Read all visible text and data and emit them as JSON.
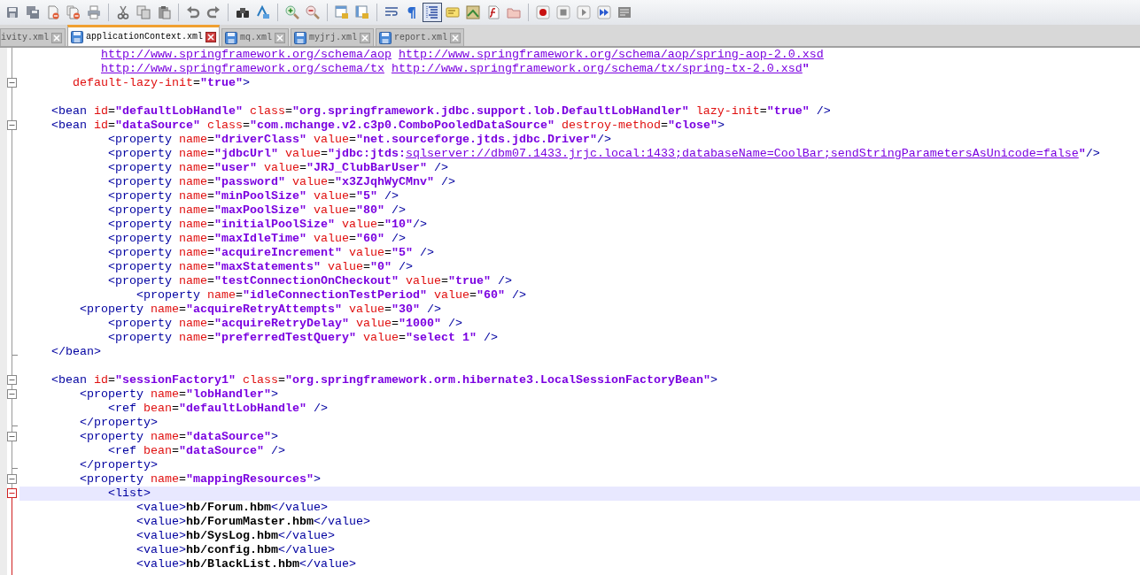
{
  "toolbar": [
    {
      "kind": "save",
      "pressed": false
    },
    {
      "kind": "save-all",
      "pressed": false
    },
    {
      "kind": "close-file",
      "pressed": false
    },
    {
      "kind": "close-all",
      "pressed": false
    },
    {
      "kind": "print",
      "pressed": false
    },
    {
      "kind": "separator"
    },
    {
      "kind": "cut",
      "pressed": false
    },
    {
      "kind": "copy",
      "pressed": false
    },
    {
      "kind": "paste",
      "pressed": false
    },
    {
      "kind": "separator"
    },
    {
      "kind": "undo",
      "pressed": false
    },
    {
      "kind": "redo",
      "pressed": false
    },
    {
      "kind": "separator"
    },
    {
      "kind": "find",
      "pressed": false
    },
    {
      "kind": "replace",
      "pressed": false
    },
    {
      "kind": "separator"
    },
    {
      "kind": "zoom-in",
      "pressed": false
    },
    {
      "kind": "zoom-out",
      "pressed": false
    },
    {
      "kind": "separator"
    },
    {
      "kind": "sync-vertical",
      "pressed": false
    },
    {
      "kind": "sync-horizontal",
      "pressed": false
    },
    {
      "kind": "separator"
    },
    {
      "kind": "word-wrap",
      "pressed": false
    },
    {
      "kind": "show-all",
      "pressed": false
    },
    {
      "kind": "indent-guide",
      "pressed": true
    },
    {
      "kind": "language",
      "pressed": false
    },
    {
      "kind": "doc-map",
      "pressed": false
    },
    {
      "kind": "function-list",
      "pressed": false
    },
    {
      "kind": "folder",
      "pressed": false
    },
    {
      "kind": "separator"
    },
    {
      "kind": "record",
      "pressed": false
    },
    {
      "kind": "stop",
      "pressed": false
    },
    {
      "kind": "play",
      "pressed": false
    },
    {
      "kind": "play-multiple",
      "pressed": false
    },
    {
      "kind": "save-macro",
      "pressed": false
    }
  ],
  "tabs": [
    {
      "label": "ivity.xml",
      "selected": false,
      "show_icon": false
    },
    {
      "label": "applicationContext.xml",
      "selected": true,
      "show_icon": true
    },
    {
      "label": "mq.xml",
      "selected": false,
      "show_icon": true
    },
    {
      "label": "myjrj.xml",
      "selected": false,
      "show_icon": true
    },
    {
      "label": "report.xml",
      "selected": false,
      "show_icon": true
    }
  ],
  "lines": [
    {
      "fold_start": false,
      "fold_end": false,
      "current": false,
      "segments": [
        {
          "kind": "link",
          "text": "http://www.springframework.org/schema/aop"
        },
        {
          "kind": "link",
          "text": "http://www.springframework.org/schema/aop/spring-aop-2.0.xsd"
        }
      ]
    },
    {
      "fold_start": false,
      "fold_end": false,
      "current": false,
      "segments": [
        {
          "kind": "link",
          "text": "http://www.springframework.org/schema/tx"
        },
        {
          "kind": "link",
          "text": "http://www.springframework.org/schema/tx/spring-tx-2.0.xsd"
        },
        {
          "kind": "value",
          "text": "\""
        }
      ]
    },
    {
      "fold_start": true,
      "fold_end": false,
      "current": false,
      "segments": [
        {
          "kind": "attr",
          "text": "default-lazy-init"
        },
        {
          "kind": "plain",
          "text": "="
        },
        {
          "kind": "value",
          "text": "\"true\""
        },
        {
          "kind": "tag",
          "text": ">"
        }
      ]
    },
    {
      "fold_start": false,
      "fold_end": false,
      "current": false
    },
    {
      "fold_start": false,
      "fold_end": false,
      "current": false,
      "segments": [
        {
          "kind": "tag",
          "text": "<bean"
        },
        {
          "kind": "attr",
          "text": " id"
        },
        {
          "kind": "plain",
          "text": "="
        },
        {
          "kind": "value",
          "text": "\"defaultLobHandle\""
        },
        {
          "kind": "attr",
          "text": " class"
        },
        {
          "kind": "plain",
          "text": "="
        },
        {
          "kind": "value",
          "text": "\"org.springframework.jdbc.support.lob.DefaultLobHandler\""
        },
        {
          "kind": "attr",
          "text": " lazy-init"
        },
        {
          "kind": "plain",
          "text": "="
        },
        {
          "kind": "value",
          "text": "\"true\""
        },
        {
          "kind": "tag",
          "text": " />"
        }
      ]
    },
    {
      "fold_start": true,
      "fold_end": false,
      "current": false,
      "segments": [
        {
          "kind": "tag",
          "text": "<bean"
        },
        {
          "kind": "attr",
          "text": " id"
        },
        {
          "kind": "plain",
          "text": "="
        },
        {
          "kind": "value",
          "text": "\"dataSource\""
        },
        {
          "kind": "attr",
          "text": " class"
        },
        {
          "kind": "plain",
          "text": "="
        },
        {
          "kind": "value",
          "text": "\"com.mchange.v2.c3p0.ComboPooledDataSource\""
        },
        {
          "kind": "attr",
          "text": " destroy-method"
        },
        {
          "kind": "plain",
          "text": "="
        },
        {
          "kind": "value",
          "text": "\"close\""
        },
        {
          "kind": "tag",
          "text": ">"
        }
      ]
    },
    {
      "fold_start": false,
      "fold_end": false,
      "current": false,
      "segments": [
        {
          "kind": "tag",
          "text": "<property"
        },
        {
          "kind": "attr",
          "text": " name"
        },
        {
          "kind": "plain",
          "text": "="
        },
        {
          "kind": "value",
          "text": "\"driverClass\""
        },
        {
          "kind": "attr",
          "text": " value"
        },
        {
          "kind": "plain",
          "text": "="
        },
        {
          "kind": "value",
          "text": "\"net.sourceforge.jtds.jdbc.Driver\""
        },
        {
          "kind": "tag",
          "text": "/>"
        }
      ]
    },
    {
      "fold_start": false,
      "fold_end": false,
      "current": false,
      "segments": [
        {
          "kind": "tag",
          "text": "<property"
        },
        {
          "kind": "attr",
          "text": " name"
        },
        {
          "kind": "plain",
          "text": "="
        },
        {
          "kind": "value",
          "text": "\"jdbcUrl\""
        },
        {
          "kind": "attr",
          "text": " value"
        },
        {
          "kind": "plain",
          "text": "="
        },
        {
          "kind": "value",
          "text": "\"jdbc:jtds:"
        },
        {
          "kind": "link",
          "text": "sqlserver://dbm07.1433.jrjc.local:1433;databaseName=CoolBar;sendStringParametersAsUnicode=false"
        },
        {
          "kind": "value",
          "text": "\""
        },
        {
          "kind": "tag",
          "text": "/>"
        }
      ]
    },
    {
      "fold_start": false,
      "fold_end": false,
      "current": false,
      "segments": [
        {
          "kind": "tag",
          "text": "<property"
        },
        {
          "kind": "attr",
          "text": " name"
        },
        {
          "kind": "plain",
          "text": "="
        },
        {
          "kind": "value",
          "text": "\"user\""
        },
        {
          "kind": "attr",
          "text": " value"
        },
        {
          "kind": "plain",
          "text": "="
        },
        {
          "kind": "value",
          "text": "\"JRJ_ClubBarUser\""
        },
        {
          "kind": "tag",
          "text": " />"
        }
      ]
    },
    {
      "fold_start": false,
      "fold_end": false,
      "current": false,
      "segments": [
        {
          "kind": "tag",
          "text": "<property"
        },
        {
          "kind": "attr",
          "text": " name"
        },
        {
          "kind": "plain",
          "text": "="
        },
        {
          "kind": "value",
          "text": "\"password\""
        },
        {
          "kind": "attr",
          "text": " value"
        },
        {
          "kind": "plain",
          "text": "="
        },
        {
          "kind": "value",
          "text": "\"x3ZJqhWyCMnv\""
        },
        {
          "kind": "tag",
          "text": " />"
        }
      ]
    },
    {
      "fold_start": false,
      "fold_end": false,
      "current": false,
      "segments": [
        {
          "kind": "tag",
          "text": "<property"
        },
        {
          "kind": "attr",
          "text": " name"
        },
        {
          "kind": "plain",
          "text": "="
        },
        {
          "kind": "value",
          "text": "\"minPoolSize\""
        },
        {
          "kind": "attr",
          "text": " value"
        },
        {
          "kind": "plain",
          "text": "="
        },
        {
          "kind": "value",
          "text": "\"5\""
        },
        {
          "kind": "tag",
          "text": " />"
        }
      ]
    },
    {
      "fold_start": false,
      "fold_end": false,
      "current": false,
      "segments": [
        {
          "kind": "tag",
          "text": "<property"
        },
        {
          "kind": "attr",
          "text": " name"
        },
        {
          "kind": "plain",
          "text": "="
        },
        {
          "kind": "value",
          "text": "\"maxPoolSize\""
        },
        {
          "kind": "attr",
          "text": " value"
        },
        {
          "kind": "plain",
          "text": "="
        },
        {
          "kind": "value",
          "text": "\"80\""
        },
        {
          "kind": "tag",
          "text": " />"
        }
      ]
    },
    {
      "fold_start": false,
      "fold_end": false,
      "current": false,
      "segments": [
        {
          "kind": "tag",
          "text": "<property"
        },
        {
          "kind": "attr",
          "text": " name"
        },
        {
          "kind": "plain",
          "text": "="
        },
        {
          "kind": "value",
          "text": "\"initialPoolSize\""
        },
        {
          "kind": "attr",
          "text": " value"
        },
        {
          "kind": "plain",
          "text": "="
        },
        {
          "kind": "value",
          "text": "\"10\""
        },
        {
          "kind": "tag",
          "text": "/>"
        }
      ]
    },
    {
      "fold_start": false,
      "fold_end": false,
      "current": false,
      "segments": [
        {
          "kind": "tag",
          "text": "<property"
        },
        {
          "kind": "attr",
          "text": " name"
        },
        {
          "kind": "plain",
          "text": "="
        },
        {
          "kind": "value",
          "text": "\"maxIdleTime\""
        },
        {
          "kind": "attr",
          "text": " value"
        },
        {
          "kind": "plain",
          "text": "="
        },
        {
          "kind": "value",
          "text": "\"60\""
        },
        {
          "kind": "tag",
          "text": " />"
        }
      ]
    },
    {
      "fold_start": false,
      "fold_end": false,
      "current": false,
      "segments": [
        {
          "kind": "tag",
          "text": "<property"
        },
        {
          "kind": "attr",
          "text": " name"
        },
        {
          "kind": "plain",
          "text": "="
        },
        {
          "kind": "value",
          "text": "\"acquireIncrement\""
        },
        {
          "kind": "attr",
          "text": " value"
        },
        {
          "kind": "plain",
          "text": "="
        },
        {
          "kind": "value",
          "text": "\"5\""
        },
        {
          "kind": "tag",
          "text": " />"
        }
      ]
    },
    {
      "fold_start": false,
      "fold_end": false,
      "current": false,
      "segments": [
        {
          "kind": "tag",
          "text": "<property"
        },
        {
          "kind": "attr",
          "text": " name"
        },
        {
          "kind": "plain",
          "text": "="
        },
        {
          "kind": "value",
          "text": "\"maxStatements\""
        },
        {
          "kind": "attr",
          "text": " value"
        },
        {
          "kind": "plain",
          "text": "="
        },
        {
          "kind": "value",
          "text": "\"0\""
        },
        {
          "kind": "tag",
          "text": " />"
        }
      ]
    },
    {
      "fold_start": false,
      "fold_end": false,
      "current": false,
      "segments": [
        {
          "kind": "tag",
          "text": "<property"
        },
        {
          "kind": "attr",
          "text": " name"
        },
        {
          "kind": "plain",
          "text": "="
        },
        {
          "kind": "value",
          "text": "\"testConnectionOnCheckout\""
        },
        {
          "kind": "attr",
          "text": " value"
        },
        {
          "kind": "plain",
          "text": "="
        },
        {
          "kind": "value",
          "text": "\"true\""
        },
        {
          "kind": "tag",
          "text": " />"
        }
      ]
    },
    {
      "fold_start": false,
      "fold_end": false,
      "current": false,
      "segments": [
        {
          "kind": "tag",
          "text": "<property"
        },
        {
          "kind": "attr",
          "text": " name"
        },
        {
          "kind": "plain",
          "text": "="
        },
        {
          "kind": "value",
          "text": "\"idleConnectionTestPeriod\""
        },
        {
          "kind": "attr",
          "text": " value"
        },
        {
          "kind": "plain",
          "text": "="
        },
        {
          "kind": "value",
          "text": "\"60\""
        },
        {
          "kind": "tag",
          "text": " />"
        }
      ]
    },
    {
      "fold_start": false,
      "fold_end": false,
      "current": false,
      "segments": [
        {
          "kind": "tag",
          "text": "<property"
        },
        {
          "kind": "attr",
          "text": " name"
        },
        {
          "kind": "plain",
          "text": "="
        },
        {
          "kind": "value",
          "text": "\"acquireRetryAttempts\""
        },
        {
          "kind": "attr",
          "text": " value"
        },
        {
          "kind": "plain",
          "text": "="
        },
        {
          "kind": "value",
          "text": "\"30\""
        },
        {
          "kind": "tag",
          "text": " />"
        }
      ]
    },
    {
      "fold_start": false,
      "fold_end": false,
      "current": false,
      "segments": [
        {
          "kind": "tag",
          "text": "<property"
        },
        {
          "kind": "attr",
          "text": " name"
        },
        {
          "kind": "plain",
          "text": "="
        },
        {
          "kind": "value",
          "text": "\"acquireRetryDelay\""
        },
        {
          "kind": "attr",
          "text": " value"
        },
        {
          "kind": "plain",
          "text": "="
        },
        {
          "kind": "value",
          "text": "\"1000\""
        },
        {
          "kind": "tag",
          "text": " />"
        }
      ]
    },
    {
      "fold_start": false,
      "fold_end": false,
      "current": false,
      "segments": [
        {
          "kind": "tag",
          "text": "<property"
        },
        {
          "kind": "attr",
          "text": " name"
        },
        {
          "kind": "plain",
          "text": "="
        },
        {
          "kind": "value",
          "text": "\"preferredTestQuery\""
        },
        {
          "kind": "attr",
          "text": " value"
        },
        {
          "kind": "plain",
          "text": "="
        },
        {
          "kind": "value",
          "text": "\"select 1\""
        },
        {
          "kind": "tag",
          "text": " />"
        }
      ]
    },
    {
      "fold_start": false,
      "fold_end": true,
      "current": false,
      "segments": [
        {
          "kind": "tag",
          "text": "</bean>"
        }
      ]
    },
    {
      "fold_start": false,
      "fold_end": false,
      "current": false
    },
    {
      "fold_start": true,
      "fold_end": false,
      "current": false,
      "segments": [
        {
          "kind": "tag",
          "text": "<bean"
        },
        {
          "kind": "attr",
          "text": " id"
        },
        {
          "kind": "plain",
          "text": "="
        },
        {
          "kind": "value",
          "text": "\"sessionFactory1\""
        },
        {
          "kind": "attr",
          "text": " class"
        },
        {
          "kind": "plain",
          "text": "="
        },
        {
          "kind": "value",
          "text": "\"org.springframework.orm.hibernate3.LocalSessionFactoryBean\""
        },
        {
          "kind": "tag",
          "text": ">"
        }
      ]
    },
    {
      "fold_start": true,
      "fold_end": false,
      "current": false,
      "segments": [
        {
          "kind": "tag",
          "text": "<property"
        },
        {
          "kind": "attr",
          "text": " name"
        },
        {
          "kind": "plain",
          "text": "="
        },
        {
          "kind": "value",
          "text": "\"lobHandler\""
        },
        {
          "kind": "tag",
          "text": ">"
        }
      ]
    },
    {
      "fold_start": false,
      "fold_end": false,
      "current": false,
      "segments": [
        {
          "kind": "tag",
          "text": "<ref"
        },
        {
          "kind": "attr",
          "text": " bean"
        },
        {
          "kind": "plain",
          "text": "="
        },
        {
          "kind": "value",
          "text": "\"defaultLobHandle\""
        },
        {
          "kind": "tag",
          "text": " />"
        }
      ]
    },
    {
      "fold_start": false,
      "fold_end": true,
      "current": false,
      "segments": [
        {
          "kind": "tag",
          "text": "</property>"
        }
      ]
    },
    {
      "fold_start": true,
      "fold_end": false,
      "current": false,
      "segments": [
        {
          "kind": "tag",
          "text": "<property"
        },
        {
          "kind": "attr",
          "text": " name"
        },
        {
          "kind": "plain",
          "text": "="
        },
        {
          "kind": "value",
          "text": "\"dataSource\""
        },
        {
          "kind": "tag",
          "text": ">"
        }
      ]
    },
    {
      "fold_start": false,
      "fold_end": false,
      "current": false,
      "segments": [
        {
          "kind": "tag",
          "text": "<ref"
        },
        {
          "kind": "attr",
          "text": " bean"
        },
        {
          "kind": "plain",
          "text": "="
        },
        {
          "kind": "value",
          "text": "\"dataSource\""
        },
        {
          "kind": "tag",
          "text": " />"
        }
      ]
    },
    {
      "fold_start": false,
      "fold_end": true,
      "current": false,
      "segments": [
        {
          "kind": "tag",
          "text": "</property>"
        }
      ]
    },
    {
      "fold_start": true,
      "fold_end": false,
      "current": false,
      "segments": [
        {
          "kind": "tag",
          "text": "<property"
        },
        {
          "kind": "attr",
          "text": " name"
        },
        {
          "kind": "plain",
          "text": "="
        },
        {
          "kind": "value",
          "text": "\"mappingResources\""
        },
        {
          "kind": "tag",
          "text": ">"
        }
      ]
    },
    {
      "fold_start": true,
      "fold_end": false,
      "current": true,
      "segments": [
        {
          "kind": "tag",
          "text": "<list>"
        }
      ]
    },
    {
      "fold_start": false,
      "fold_end": false,
      "current": false,
      "segments": [
        {
          "kind": "tag",
          "text": "<value>"
        },
        {
          "kind": "text",
          "text": "hb/Forum.hbm"
        },
        {
          "kind": "tag",
          "text": "</value>"
        }
      ]
    },
    {
      "fold_start": false,
      "fold_end": false,
      "current": false,
      "segments": [
        {
          "kind": "tag",
          "text": "<value>"
        },
        {
          "kind": "text",
          "text": "hb/ForumMaster.hbm"
        },
        {
          "kind": "tag",
          "text": "</value>"
        }
      ]
    },
    {
      "fold_start": false,
      "fold_end": false,
      "current": false,
      "segments": [
        {
          "kind": "tag",
          "text": "<value>"
        },
        {
          "kind": "text",
          "text": "hb/SysLog.hbm"
        },
        {
          "kind": "tag",
          "text": "</value>"
        }
      ]
    },
    {
      "fold_start": false,
      "fold_end": false,
      "current": false,
      "segments": [
        {
          "kind": "tag",
          "text": "<value>"
        },
        {
          "kind": "text",
          "text": "hb/config.hbm"
        },
        {
          "kind": "tag",
          "text": "</value>"
        }
      ]
    },
    {
      "fold_start": false,
      "fold_end": false,
      "current": false,
      "segments": [
        {
          "kind": "tag",
          "text": "<value>"
        },
        {
          "kind": "text",
          "text": "hb/BlackList.hbm"
        },
        {
          "kind": "tag",
          "text": "</value>"
        }
      ]
    }
  ]
}
